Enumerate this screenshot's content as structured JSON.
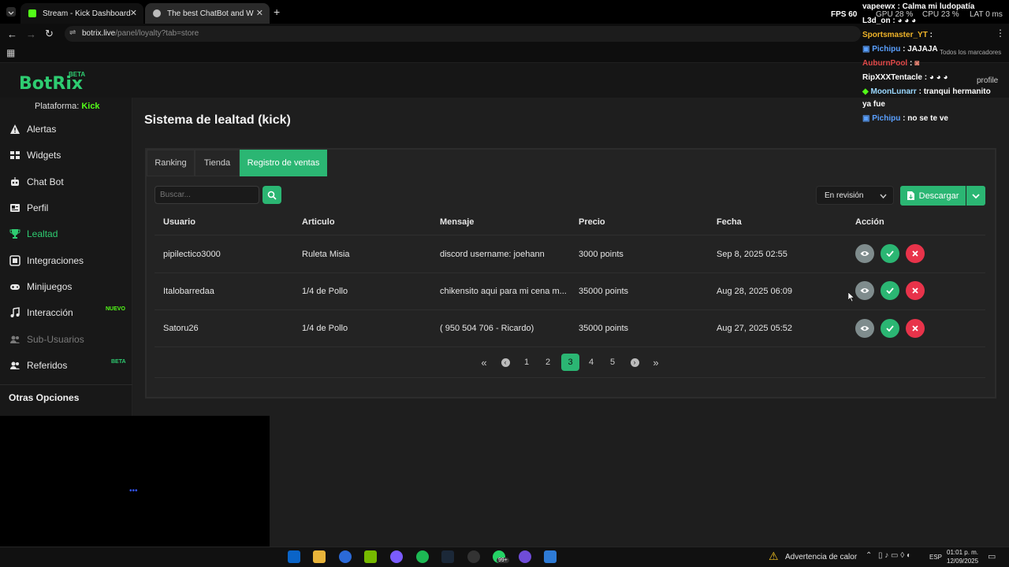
{
  "browser": {
    "tabs": [
      {
        "title": "Stream - Kick Dashboard",
        "active": false
      },
      {
        "title": "The best ChatBot and Widgets",
        "active": true
      }
    ],
    "url_host": "botrix.live",
    "url_path": "/panel/loyalty?tab=store",
    "bookmarks_label": "Todos los marcadores",
    "profile_label": "profile"
  },
  "perf": {
    "fps_label": "FPS",
    "fps_value": "60",
    "gpu_label": "GPU",
    "gpu_value": "28 %",
    "cpu_label": "CPU",
    "cpu_value": "23 %",
    "lat_label": "LAT",
    "lat_value": "0 ms"
  },
  "brand": {
    "name": "BotRix",
    "badge": "BETA"
  },
  "sidebar": {
    "platform_label": "Plataforma:",
    "platform_value": "Kick",
    "items": [
      {
        "label": "Alertas",
        "icon": "alert-triangle-icon"
      },
      {
        "label": "Widgets",
        "icon": "grid-icon"
      },
      {
        "label": "Chat Bot",
        "icon": "robot-icon"
      },
      {
        "label": "Perfil",
        "icon": "id-card-icon"
      },
      {
        "label": "Lealtad",
        "icon": "trophy-icon",
        "active": true
      },
      {
        "label": "Integraciones",
        "icon": "plug-icon"
      },
      {
        "label": "Minijuegos",
        "icon": "gamepad-icon"
      },
      {
        "label": "Interacción",
        "icon": "music-icon",
        "badge": "NUEVO"
      },
      {
        "label": "Sub-Usuarios",
        "icon": "users-icon",
        "disabled": true
      },
      {
        "label": "Referidos",
        "icon": "users-icon",
        "badge": "BETA"
      }
    ],
    "other_options": "Otras Opciones"
  },
  "page": {
    "title": "Sistema de lealtad (kick)",
    "tabs": [
      "Ranking",
      "Tienda",
      "Registro de ventas"
    ],
    "active_tab": 2,
    "search_placeholder": "Buscar...",
    "status_select": "En revisión",
    "download_label": "Descargar",
    "columns": [
      "Usuario",
      "Articulo",
      "Mensaje",
      "Precio",
      "Fecha",
      "Acción"
    ],
    "rows": [
      {
        "user": "pipilectico3000",
        "item": "Ruleta Misia",
        "message": "discord username: joehann",
        "price": "3000 points",
        "date": "Sep 8, 2025 02:55"
      },
      {
        "user": "Italobarredaa",
        "item": "1/4 de Pollo",
        "message": "chikensito aqui para mi cena m...",
        "price": "35000 points",
        "date": "Aug 28, 2025 06:09"
      },
      {
        "user": "Satoru26",
        "item": "1/4 de Pollo",
        "message": "( 950 504 706 - Ricardo)",
        "price": "35000 points",
        "date": "Aug 27, 2025 05:52"
      }
    ],
    "pagination": {
      "pages": [
        "1",
        "2",
        "3",
        "4",
        "5"
      ],
      "current": "3"
    }
  },
  "chat": [
    {
      "name": "vapeewx",
      "text": ": Calma mi ludopatía",
      "color": "#ffffff"
    },
    {
      "name": "L3d_on",
      "text": ":",
      "color": "#ffffff"
    },
    {
      "name": "Sportsmaster_YT",
      "text": ":",
      "color": "#f0b429"
    },
    {
      "name": "Pichipu",
      "text": ": JAJAJA",
      "color": "#5aa0ff"
    },
    {
      "name": "AuburnPool",
      "text": ":",
      "color": "#e04848"
    },
    {
      "name": "RipXXXTentacle",
      "text": ":",
      "color": "#ffffff"
    },
    {
      "name": "MoonLunarr",
      "text": ": tranqui hermanito",
      "color": "#9ad8ff"
    },
    {
      "name": "",
      "text": "ya fue",
      "color": "#ffffff"
    },
    {
      "name": "Pichipu",
      "text": ": no se te ve",
      "color": "#5aa0ff"
    }
  ],
  "taskbar": {
    "heat_warning": "Advertencia de calor",
    "lang": "ESP",
    "time": "01:01 p. m.",
    "date": "12/09/2025",
    "badge_count": "99+"
  },
  "colors": {
    "accent": "#2ecc71",
    "danger": "#e8334a",
    "muted": "#7f8c8d"
  }
}
